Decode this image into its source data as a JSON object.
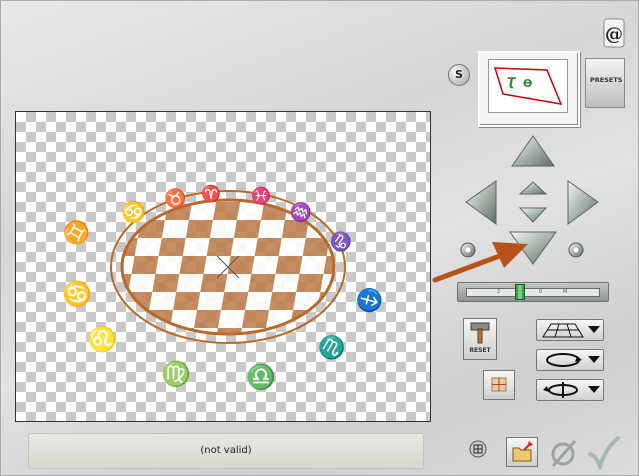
{
  "status": {
    "text": "(not valid)"
  },
  "controls": {
    "s_label": "S",
    "presets_label": "PRESETS",
    "reset_label": "RESET",
    "slider_ticks": [
      "2",
      "0",
      "M"
    ]
  },
  "icons": {
    "help": "help-icon",
    "arrow_up": "arrow-up-icon",
    "arrow_down": "arrow-down-icon",
    "arrow_left": "arrow-left-icon",
    "arrow_right": "arrow-right-icon",
    "rotate_left": "rotate-left-icon",
    "rotate_right": "rotate-right-icon",
    "cancel": "cancel-icon",
    "ok": "checkmark-icon",
    "folder": "folder-import-icon"
  },
  "colors": {
    "pattern": "#b96a2b",
    "arrow": "#b5531a"
  }
}
